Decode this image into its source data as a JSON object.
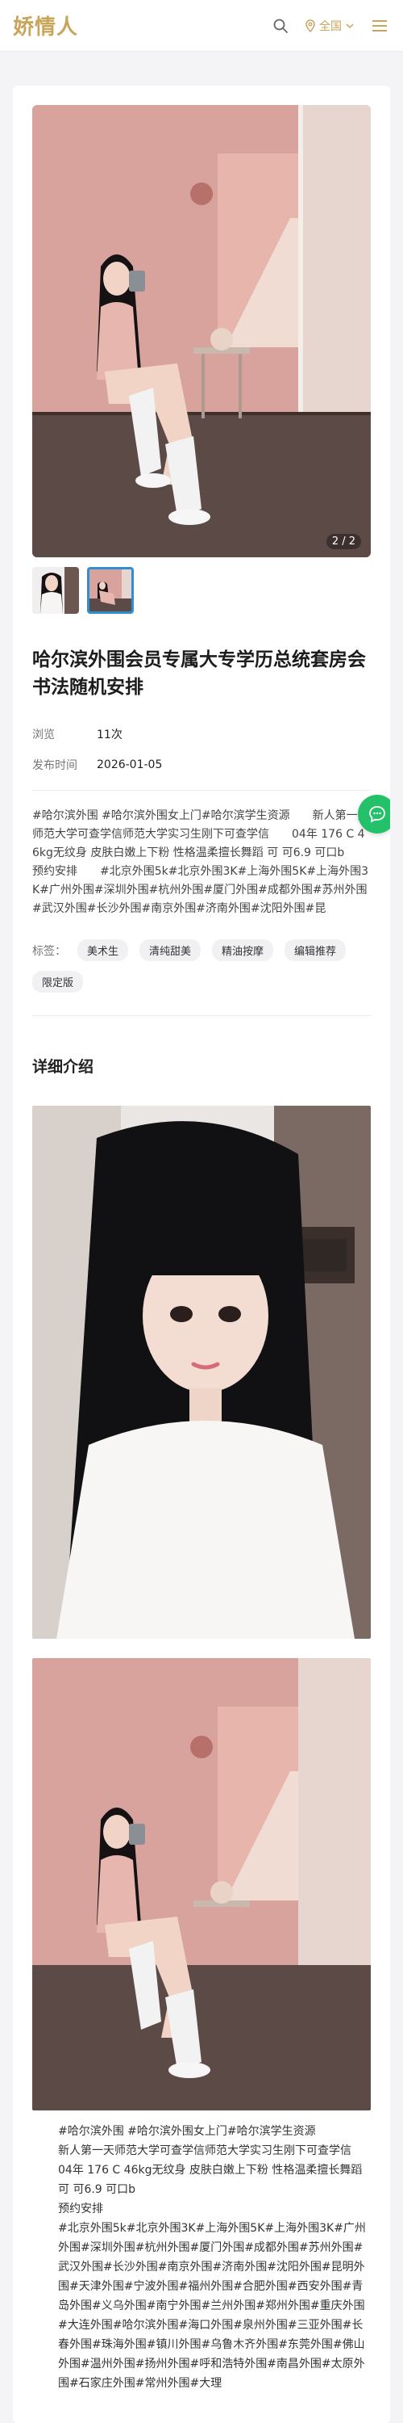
{
  "header": {
    "logo": "娇情人",
    "region_label": "全国",
    "colors": {
      "brand": "#c9a55a"
    }
  },
  "gallery": {
    "counter": "2 / 2",
    "thumbnails": 2,
    "active_index": 1
  },
  "post": {
    "title": "哈尔滨外围会员专属大专学历总统套房会书法随机安排",
    "meta": [
      {
        "label": "浏览",
        "value": "11次"
      },
      {
        "label": "发布时间",
        "value": "2026-01-05"
      }
    ],
    "description": "#哈尔滨外围 #哈尔滨外围女上门#哈尔滨学生资源　　新人第一天师范大学可查学信师范大学实习生刚下可查学信　　04年 176 C 46kg无纹身 皮肤白嫩上下粉 性格温柔擅长舞蹈 可 可6.9 可口b　　预约安排　　#北京外围5k#北京外围3K#上海外围5K#上海外围3K#广州外围#深圳外围#杭州外围#厦门外围#成都外围#苏州外围#武汉外围#长沙外围#南京外围#济南外围#沈阳外围#昆",
    "tags_label": "标签：",
    "tags": [
      "美术生",
      "清纯甜美",
      "精油按摩",
      "编辑推荐",
      "限定版"
    ]
  },
  "details": {
    "section_title": "详细介绍",
    "paragraphs": [
      "#哈尔滨外围 #哈尔滨外围女上门#哈尔滨学生资源",
      "新人第一天师范大学可查学信师范大学实习生刚下可查学信",
      "04年 176 C 46kg无纹身 皮肤白嫩上下粉 性格温柔擅长舞蹈 可 可6.9 可口b",
      "预约安排",
      "#北京外围5k#北京外围3K#上海外围5K#上海外围3K#广州外围#深圳外围#杭州外围#厦门外围#成都外围#苏州外围#武汉外围#长沙外围#南京外围#济南外围#沈阳外围#昆明外围#天津外围#宁波外围#福州外围#合肥外围#西安外围#青岛外围#义乌外围#南宁外围#兰州外围#郑州外围#重庆外围#大连外围#哈尔滨外围#海口外围#泉州外围#三亚外围#长春外围#珠海外围#镇川外围#乌鲁木齐外围#东莞外围#佛山外围#温州外围#扬州外围#呼和浩特外围#南昌外围#太原外围#石家庄外围#常州外围#大理"
    ]
  }
}
